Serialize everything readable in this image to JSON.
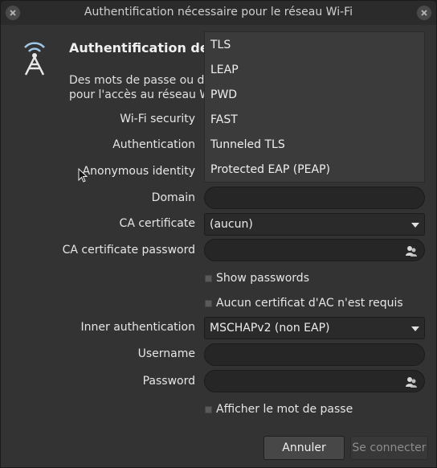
{
  "window": {
    "title": "Authentification nécessaire pour le réseau Wi-Fi"
  },
  "header": {
    "title": "Authentification dem",
    "description": "Des mots de passe ou des\npour l'accès au réseau Wi"
  },
  "form": {
    "wifi_security_label": "Wi-Fi security",
    "authentication_label": "Authentication",
    "anonymous_identity_label": "Anonymous identity",
    "domain_label": "Domain",
    "domain_value": "",
    "ca_certificate_label": "CA certificate",
    "ca_certificate_value": "(aucun)",
    "ca_certificate_password_label": "CA certificate password",
    "ca_certificate_password_value": "",
    "show_passwords_label": "Show passwords",
    "show_passwords_checked": false,
    "no_ca_required_label": "Aucun certificat d'AC n'est requis",
    "no_ca_required_checked": false,
    "inner_authentication_label": "Inner authentication",
    "inner_authentication_value": "MSCHAPv2 (non EAP)",
    "username_label": "Username",
    "username_value": "",
    "password_label": "Password",
    "password_value": "",
    "show_password_label": "Afficher le mot de passe",
    "show_password_checked": false
  },
  "authentication_dropdown": {
    "options": [
      "TLS",
      "LEAP",
      "PWD",
      "FAST",
      "Tunneled TLS",
      "Protected EAP (PEAP)"
    ]
  },
  "buttons": {
    "cancel": "Annuler",
    "connect": "Se connecter"
  }
}
